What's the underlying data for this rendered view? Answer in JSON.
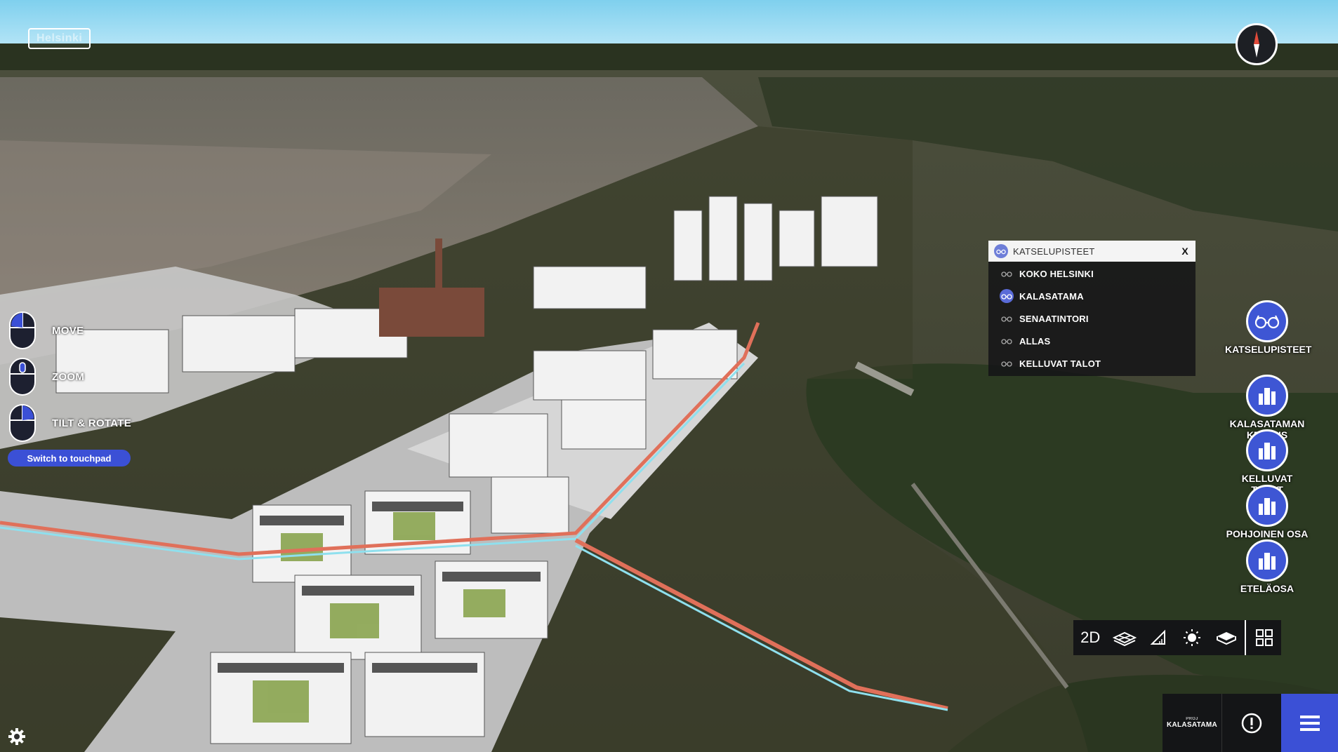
{
  "map": {
    "city_label": "Helsinki"
  },
  "controls_help": {
    "items": [
      {
        "label": "MOVE"
      },
      {
        "label": "ZOOM"
      },
      {
        "label": "TILT & ROTATE"
      }
    ],
    "touchpad_button": "Switch to touchpad"
  },
  "viewpoints": {
    "title": "KATSELUPISTEET",
    "close": "X",
    "items": [
      {
        "label": "KOKO HELSINKI",
        "active": false
      },
      {
        "label": "KALASATAMA",
        "active": true
      },
      {
        "label": "SENAATINTORI",
        "active": false
      },
      {
        "label": "ALLAS",
        "active": false
      },
      {
        "label": "KELLUVAT TALOT",
        "active": false
      }
    ]
  },
  "side_nav": [
    {
      "label": "KATSELUPISTEET",
      "icon": "glasses-icon"
    },
    {
      "label": "KALASATAMAN\nKESKUS",
      "icon": "buildings-icon"
    },
    {
      "label": "KELLUVAT TALOT",
      "icon": "buildings-icon"
    },
    {
      "label": "POHJOINEN OSA",
      "icon": "buildings-icon"
    },
    {
      "label": "ETELÄOSA",
      "icon": "buildings-icon"
    }
  ],
  "toolbar": {
    "mode_2d": "2D",
    "tools": [
      "layers-icon",
      "measure-icon",
      "sun-icon",
      "box-icon",
      "grid-icon"
    ]
  },
  "bottom_bar": {
    "brand_small": "PROJ",
    "brand_name": "KALASATAMA"
  },
  "colors": {
    "accent": "#3b50d6",
    "panel_dark": "#141517"
  }
}
